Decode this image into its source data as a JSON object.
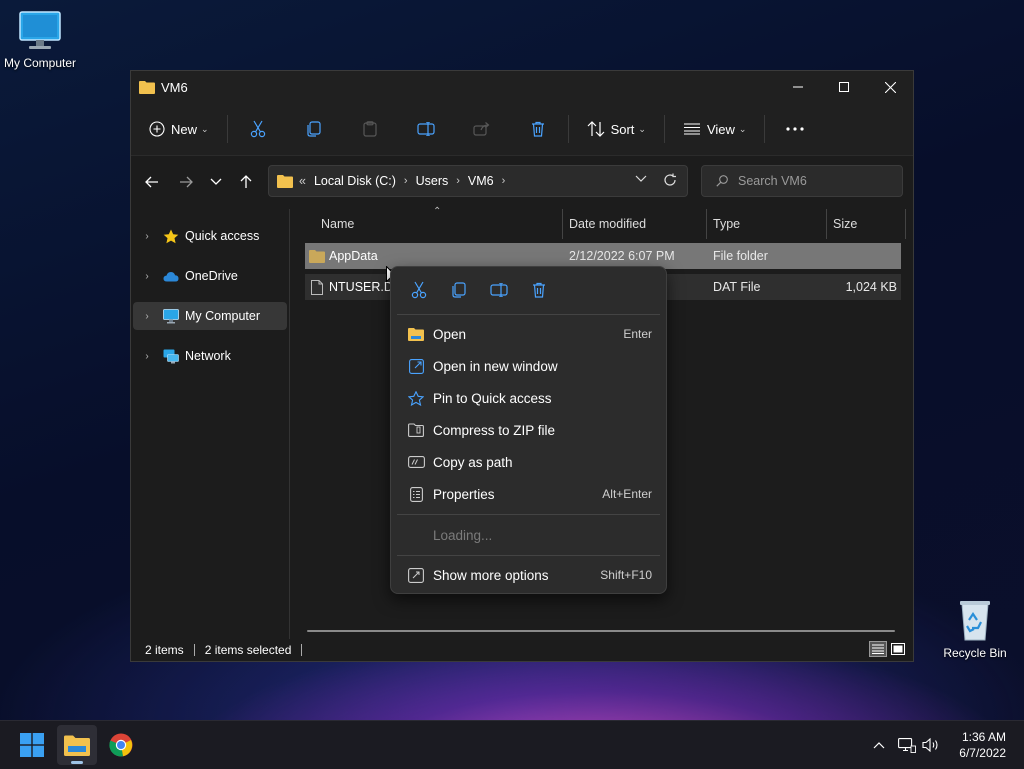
{
  "desktop": {
    "icons": [
      {
        "label": "My Computer"
      },
      {
        "label": "Recycle Bin"
      }
    ]
  },
  "window": {
    "title": "VM6",
    "toolbar": {
      "new_label": "New",
      "sort_label": "Sort",
      "view_label": "View"
    },
    "address": {
      "overflow": "«",
      "crumbs": [
        "Local Disk (C:)",
        "Users",
        "VM6"
      ]
    },
    "search": {
      "placeholder": "Search VM6"
    },
    "sidebar": {
      "items": [
        {
          "label": "Quick access"
        },
        {
          "label": "OneDrive"
        },
        {
          "label": "My Computer"
        },
        {
          "label": "Network"
        }
      ]
    },
    "columns": {
      "name": "Name",
      "date": "Date modified",
      "type": "Type",
      "size": "Size"
    },
    "files": [
      {
        "name": "AppData",
        "date": "2/12/2022 6:07 PM",
        "type": "File folder",
        "size": ""
      },
      {
        "name": "NTUSER.DA",
        "date": "",
        "type": "DAT File",
        "size": "1,024 KB"
      }
    ],
    "status": {
      "count": "2 items",
      "selected": "2 items selected"
    }
  },
  "context_menu": {
    "items": [
      {
        "label": "Open",
        "shortcut": "Enter"
      },
      {
        "label": "Open in new window",
        "shortcut": ""
      },
      {
        "label": "Pin to Quick access",
        "shortcut": ""
      },
      {
        "label": "Compress to ZIP file",
        "shortcut": ""
      },
      {
        "label": "Copy as path",
        "shortcut": ""
      },
      {
        "label": "Properties",
        "shortcut": "Alt+Enter"
      }
    ],
    "loading_label": "Loading...",
    "more": {
      "label": "Show more options",
      "shortcut": "Shift+F10"
    }
  },
  "taskbar": {
    "time": "1:36 AM",
    "date": "6/7/2022"
  },
  "colors": {
    "accent": "#4aa3ff",
    "folder": "#f2c14e",
    "selection": "#777777"
  }
}
